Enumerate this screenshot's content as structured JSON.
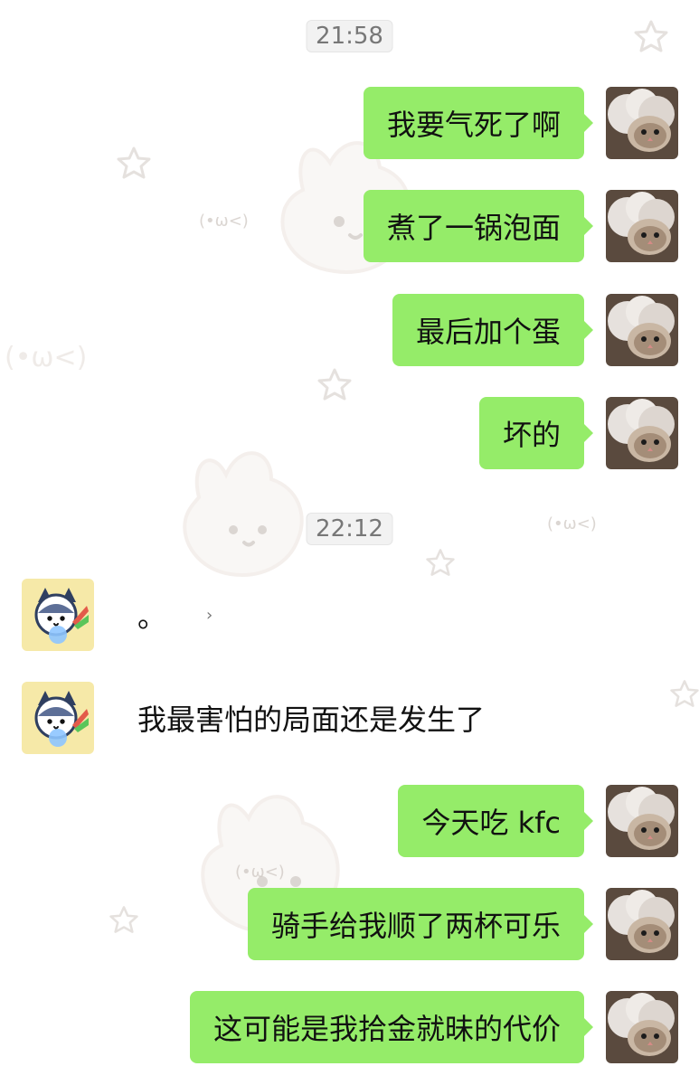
{
  "colors": {
    "self_bubble": "#95ec69",
    "other_bubble": "#ffffff",
    "time_pill_bg": "#f2f2f2",
    "time_text": "#777777",
    "text": "#111111"
  },
  "chat": {
    "timestamps": [
      "21:58",
      "22:12"
    ],
    "messages": [
      {
        "from": "self",
        "text": "我要气死了啊"
      },
      {
        "from": "self",
        "text": "煮了一锅泡面"
      },
      {
        "from": "self",
        "text": "最后加个蛋"
      },
      {
        "from": "self",
        "text": "坏的"
      },
      {
        "from": "other",
        "text": "。"
      },
      {
        "from": "other",
        "text": "我最害怕的局面还是发生了"
      },
      {
        "from": "self",
        "text": "今天吃 kfc"
      },
      {
        "from": "self",
        "text": "骑手给我顺了两杯可乐"
      },
      {
        "from": "self",
        "text": "这可能是我拾金就昧的代价"
      }
    ]
  },
  "icons": {
    "self_avatar": "cat-photo-avatar-icon",
    "other_avatar": "kitty-sticker-avatar-icon",
    "background_decor": [
      "bunny-sticker-icon",
      "star-sticker-icon",
      "face-sticker-icon"
    ]
  }
}
